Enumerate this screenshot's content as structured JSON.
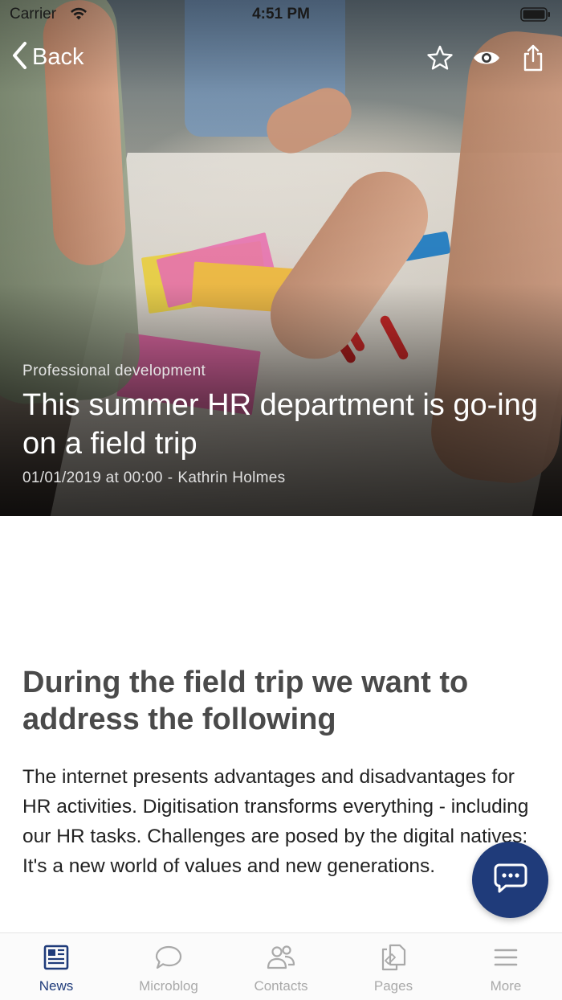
{
  "status_bar": {
    "carrier": "Carrier",
    "time": "4:51 PM"
  },
  "nav": {
    "back_label": "Back",
    "icons": [
      "star-icon",
      "eye-icon",
      "share-icon"
    ]
  },
  "hero": {
    "category": "Professional development",
    "title": "This summer HR department is go-ing on a field trip",
    "date": "01/01/2019 at 00:00",
    "separator": "-",
    "author": "Kathrin Holmes"
  },
  "article": {
    "heading": "During the field trip we want to address the following",
    "body": "The internet presents advantages and disadvantages for HR activities. Digitisation transforms everything - including our HR tasks. Challenges are posed by the digital natives: It's a new world of values and new generations."
  },
  "tab_bar": {
    "items": [
      {
        "label": "News",
        "icon": "news-icon",
        "active": true
      },
      {
        "label": "Microblog",
        "icon": "microblog-icon",
        "active": false
      },
      {
        "label": "Contacts",
        "icon": "contacts-icon",
        "active": false
      },
      {
        "label": "Pages",
        "icon": "pages-icon",
        "active": false
      },
      {
        "label": "More",
        "icon": "more-icon",
        "active": false
      }
    ]
  },
  "colors": {
    "accent": "#1f3b7a",
    "tab_inactive": "#a9a9a9",
    "heading": "#4a4a4a"
  }
}
